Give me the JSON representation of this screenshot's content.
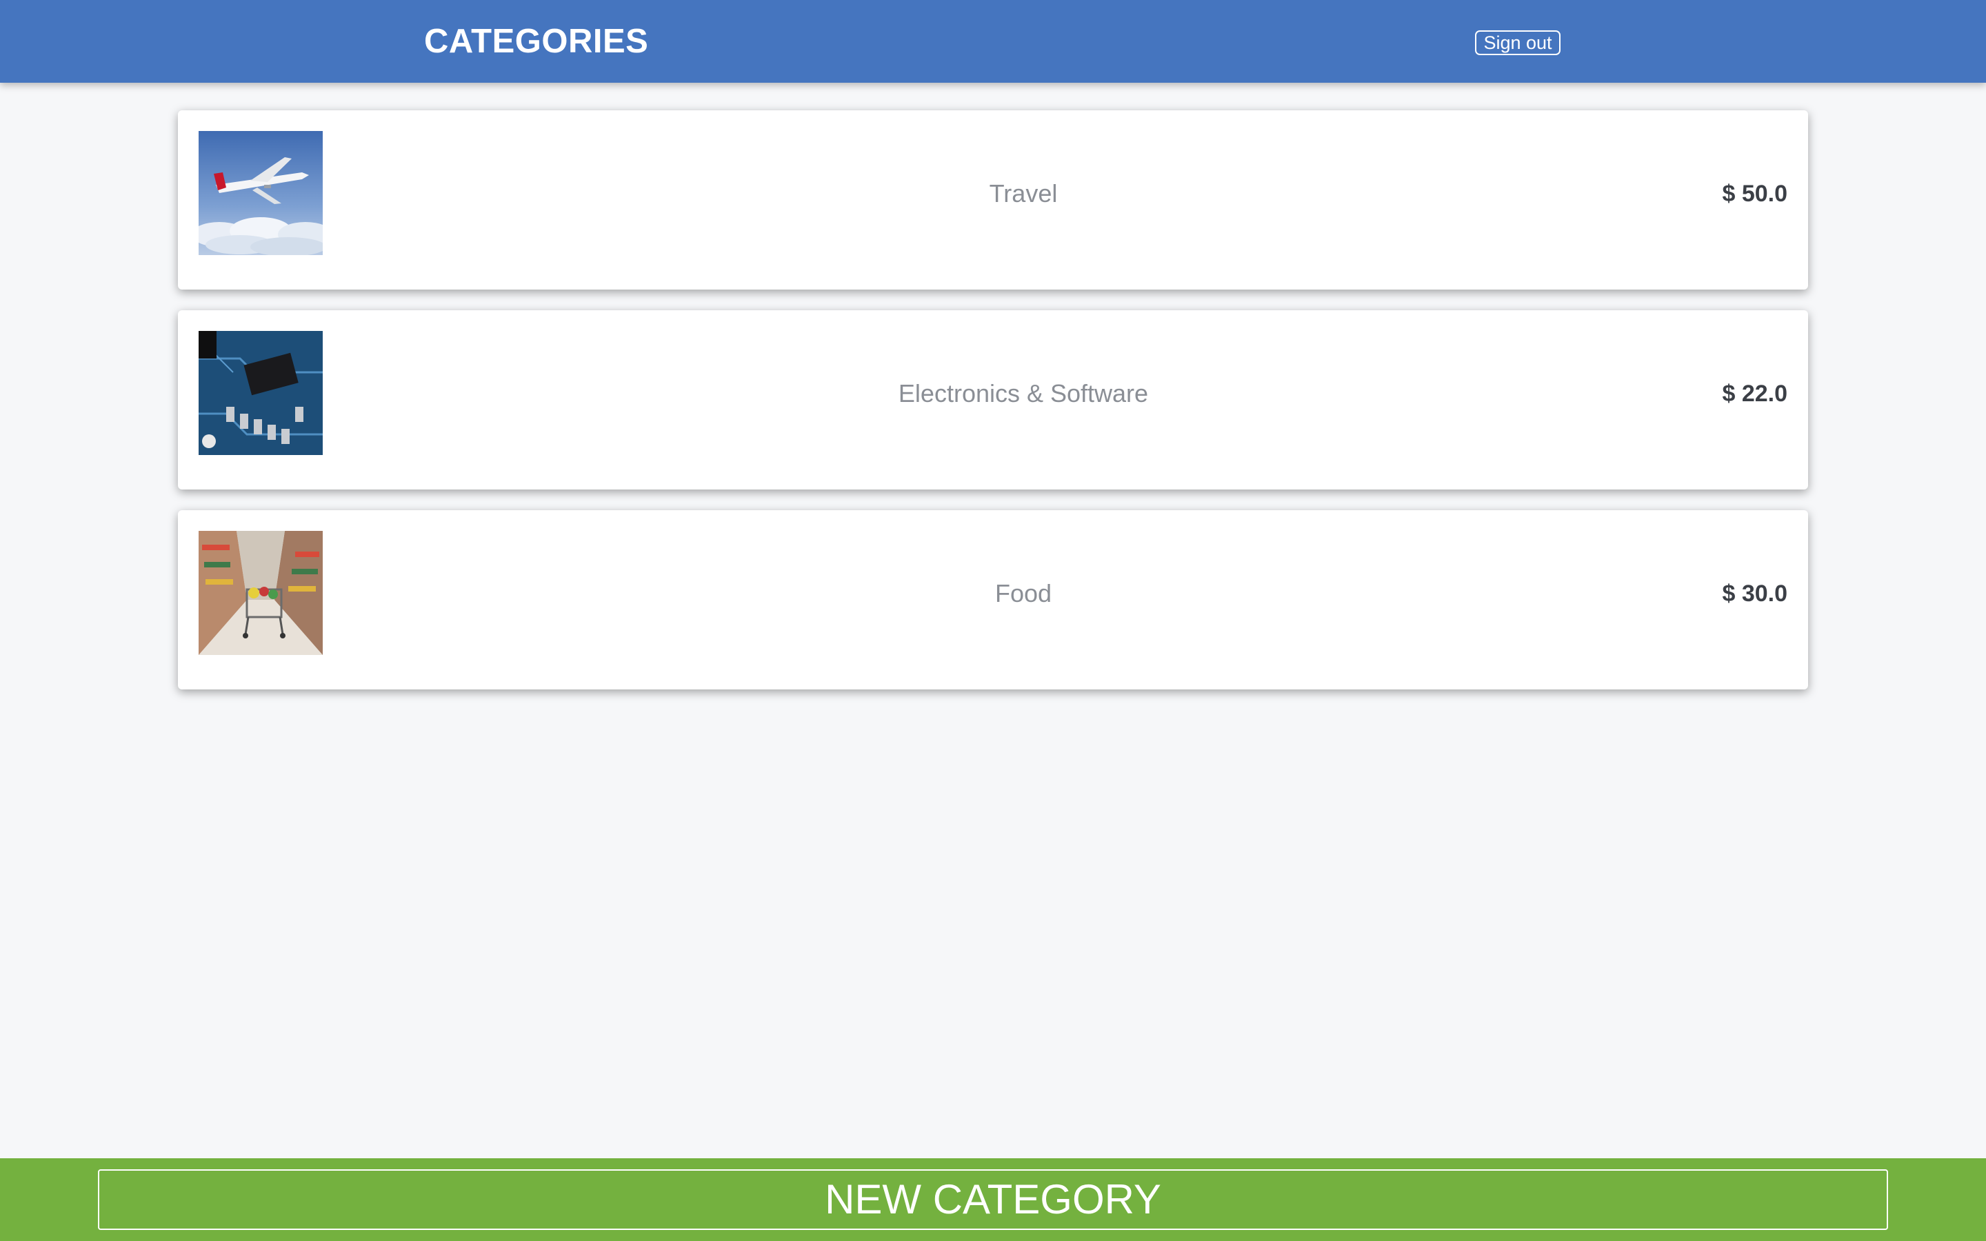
{
  "header": {
    "title": "CATEGORIES",
    "signout_label": "Sign out",
    "background": "#4575bf"
  },
  "categories": [
    {
      "name": "Travel",
      "price": "$ 50.0",
      "image": "airplane-photo"
    },
    {
      "name": "Electronics & Software",
      "price": "$ 22.0",
      "image": "circuit-board-photo"
    },
    {
      "name": "Food",
      "price": "$ 30.0",
      "image": "grocery-cart-photo"
    }
  ],
  "footer": {
    "new_label": "NEW CATEGORY",
    "background": "#74b13f"
  }
}
